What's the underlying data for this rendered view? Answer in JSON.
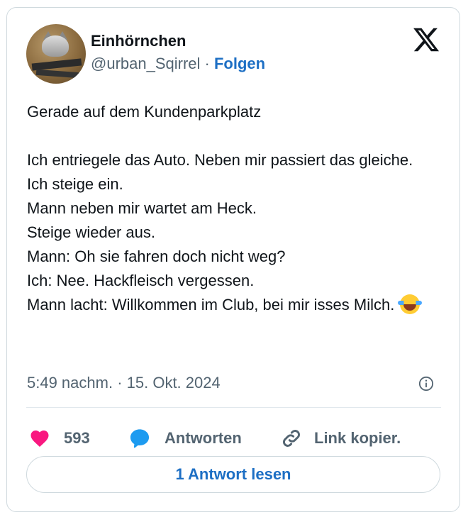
{
  "author": {
    "name": "Einhörnchen",
    "handle": "@urban_Sqirrel",
    "separator": " · ",
    "follow_label": "Folgen"
  },
  "tweet": {
    "text": "Gerade auf dem Kundenparkplatz\n\nIch entriegele das Auto. Neben mir passiert das gleiche.\nIch steige ein.\nMann neben mir wartet am Heck.\nSteige wieder aus.\nMann: Oh sie fahren doch nicht weg?\nIch: Nee. Hackfleisch vergessen.\nMann lacht: Willkommen im Club, bei mir isses Milch.",
    "emoji": "face-with-tears-of-joy"
  },
  "meta": {
    "time": "5:49 nachm.",
    "separator": " · ",
    "date": "15. Okt. 2024"
  },
  "actions": {
    "like_count": "593",
    "reply_label": "Antworten",
    "copy_label": "Link kopier."
  },
  "read_replies_label": "1 Antwort lesen",
  "colors": {
    "accent": "#1d6fc4",
    "like": "#f91880",
    "reply": "#1d9bf0",
    "muted": "#536471",
    "border": "#cfd9de"
  },
  "icons": [
    "x-logo-icon",
    "info-icon",
    "heart-icon",
    "reply-bubble-icon",
    "link-icon"
  ]
}
